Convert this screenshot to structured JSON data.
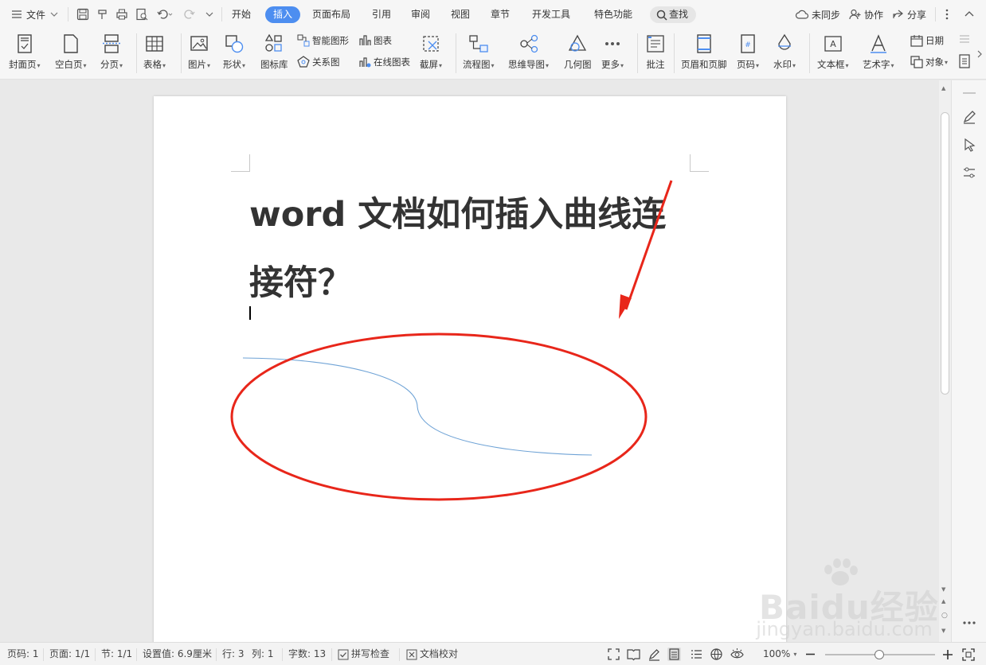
{
  "menubar": {
    "file_label": "文件",
    "tabs": [
      "开始",
      "插入",
      "页面布局",
      "引用",
      "审阅",
      "视图",
      "章节",
      "开发工具",
      "特色功能"
    ],
    "active_tab": "插入",
    "search_label": "查找",
    "sync_label": "未同步",
    "collab_label": "协作",
    "share_label": "分享"
  },
  "ribbon": {
    "cover_page": "封面页",
    "blank_page": "空白页",
    "page_break": "分页",
    "table": "表格",
    "picture": "图片",
    "shape": "形状",
    "icon_library": "图标库",
    "smart_shape": "智能图形",
    "chart": "图表",
    "relation_diagram": "关系图",
    "online_chart": "在线图表",
    "screenshot": "截屏",
    "flowchart": "流程图",
    "mindmap": "思维导图",
    "geometry": "几何图",
    "more": "更多",
    "comment": "批注",
    "header_footer": "页眉和页脚",
    "page_number": "页码",
    "watermark": "水印",
    "text_box": "文本框",
    "word_art": "艺术字",
    "date": "日期",
    "object": "对象"
  },
  "document": {
    "title": "word 文档如何插入曲线连接符？"
  },
  "annotation_colors": {
    "ellipse": "#e8261a",
    "arrow": "#e8261a",
    "curve": "#6fa3d6"
  },
  "statusbar": {
    "page_no": "页码: 1",
    "pages": "页面: 1/1",
    "section": "节: 1/1",
    "setting": "设置值: 6.9厘米",
    "row": "行: 3",
    "col": "列: 1",
    "word_count": "字数: 13",
    "spell_check": "拼写检查",
    "doc_proof": "文档校对",
    "zoom": "100%"
  },
  "watermark": {
    "brand": "Baidu经验",
    "url": "jingyan.baidu.com"
  }
}
